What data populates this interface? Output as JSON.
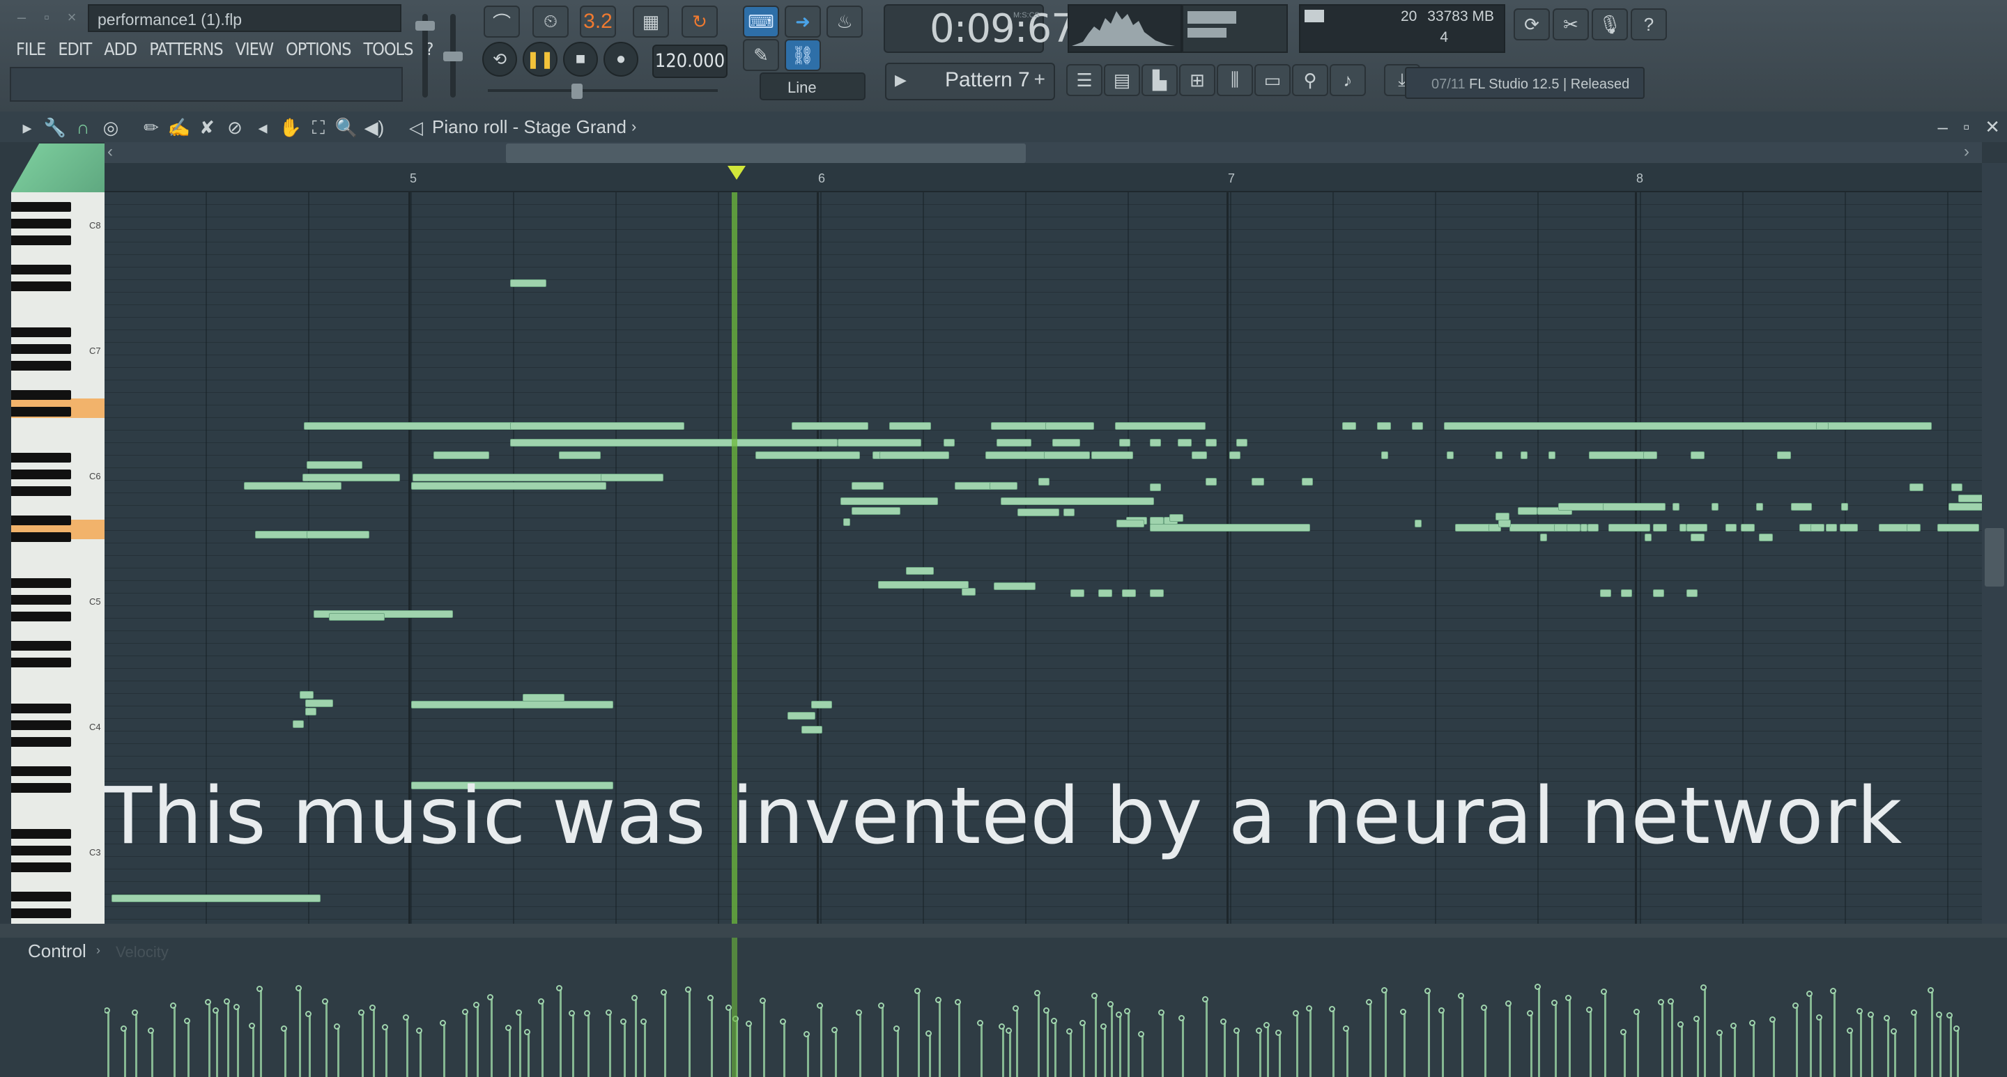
{
  "window": {
    "file_title": "performance1 (1).flp"
  },
  "menu": {
    "items": [
      "FILE",
      "EDIT",
      "ADD",
      "PATTERNS",
      "VIEW",
      "OPTIONS",
      "TOOLS",
      "?"
    ]
  },
  "transport": {
    "time": "0:09:67",
    "time_unit": "M:S:CS",
    "tempo": "120.000",
    "pattern": "Pattern 7",
    "snap": "Line",
    "counter_label": "3.2"
  },
  "monitor": {
    "memory": "33783 MB",
    "polyphony": "20",
    "cpu": "4"
  },
  "news": {
    "index": "07/11",
    "text": "FL Studio 12.5 | Released"
  },
  "piano_roll": {
    "title": "Piano roll - Stage Grand",
    "bars": [
      "5",
      "6",
      "7",
      "8"
    ],
    "octaves": [
      "C8",
      "C7",
      "C6",
      "C5",
      "C4",
      "C3"
    ]
  },
  "subtitle": "This music was invented by a neural network",
  "control": {
    "label": "Control",
    "param": "Velocity"
  },
  "colors": {
    "note": "#9fd3ad",
    "playhead": "#6eb93c",
    "accent_orange": "#f07a30",
    "highlight_key": "#f2b36b"
  }
}
